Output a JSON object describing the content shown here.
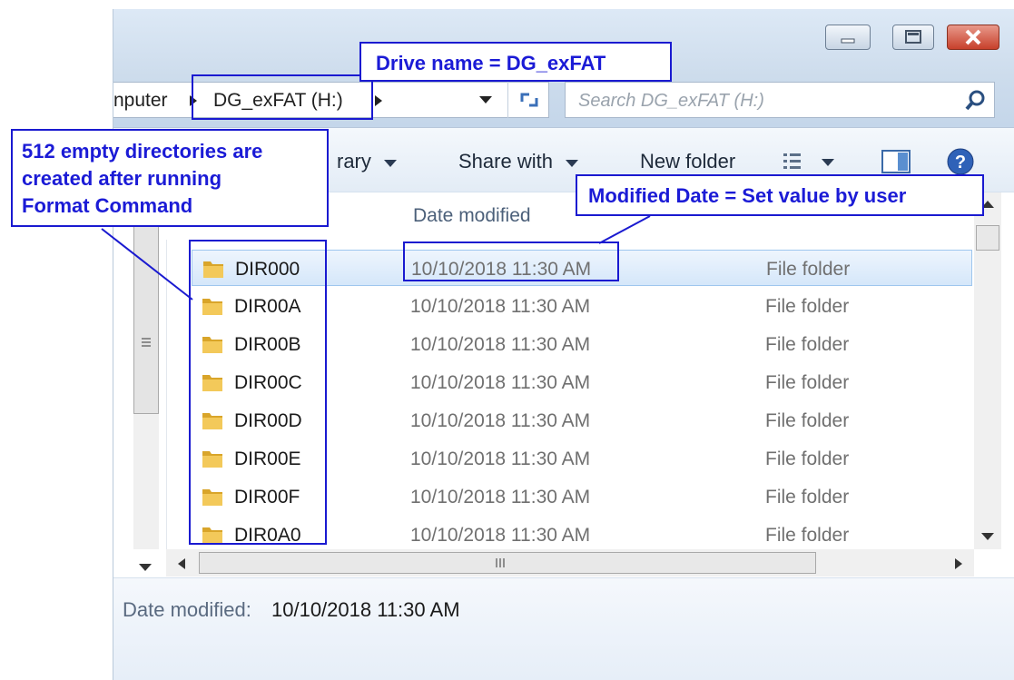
{
  "address": {
    "crumb_prefix": "nputer",
    "crumb_current": "DG_exFAT (H:)",
    "search_placeholder": "Search DG_exFAT (H:)"
  },
  "toolbar": {
    "library_label": "rary",
    "share_label": "Share with",
    "newfolder_label": "New folder"
  },
  "columns": {
    "date_modified": "Date modified"
  },
  "files": [
    {
      "name": "DIR000",
      "date": "10/10/2018 11:30 AM",
      "type": "File folder"
    },
    {
      "name": "DIR00A",
      "date": "10/10/2018 11:30 AM",
      "type": "File folder"
    },
    {
      "name": "DIR00B",
      "date": "10/10/2018 11:30 AM",
      "type": "File folder"
    },
    {
      "name": "DIR00C",
      "date": "10/10/2018 11:30 AM",
      "type": "File folder"
    },
    {
      "name": "DIR00D",
      "date": "10/10/2018 11:30 AM",
      "type": "File folder"
    },
    {
      "name": "DIR00E",
      "date": "10/10/2018 11:30 AM",
      "type": "File folder"
    },
    {
      "name": "DIR00F",
      "date": "10/10/2018 11:30 AM",
      "type": "File folder"
    },
    {
      "name": "DIR0A0",
      "date": "10/10/2018 11:30 AM",
      "type": "File folder"
    }
  ],
  "details": {
    "label": "Date modified:",
    "value": "10/10/2018 11:30 AM"
  },
  "annotations": {
    "drive_name": "Drive name = DG_exFAT",
    "empty_dirs_line1": "512 empty directories are",
    "empty_dirs_line2": "created after running",
    "empty_dirs_line3": "Format Command",
    "modified_date": "Modified Date = Set value by user"
  },
  "colors": {
    "annotation": "#1a1ad0",
    "selection": "#d5e7fa",
    "folder": "#e8b73c"
  }
}
